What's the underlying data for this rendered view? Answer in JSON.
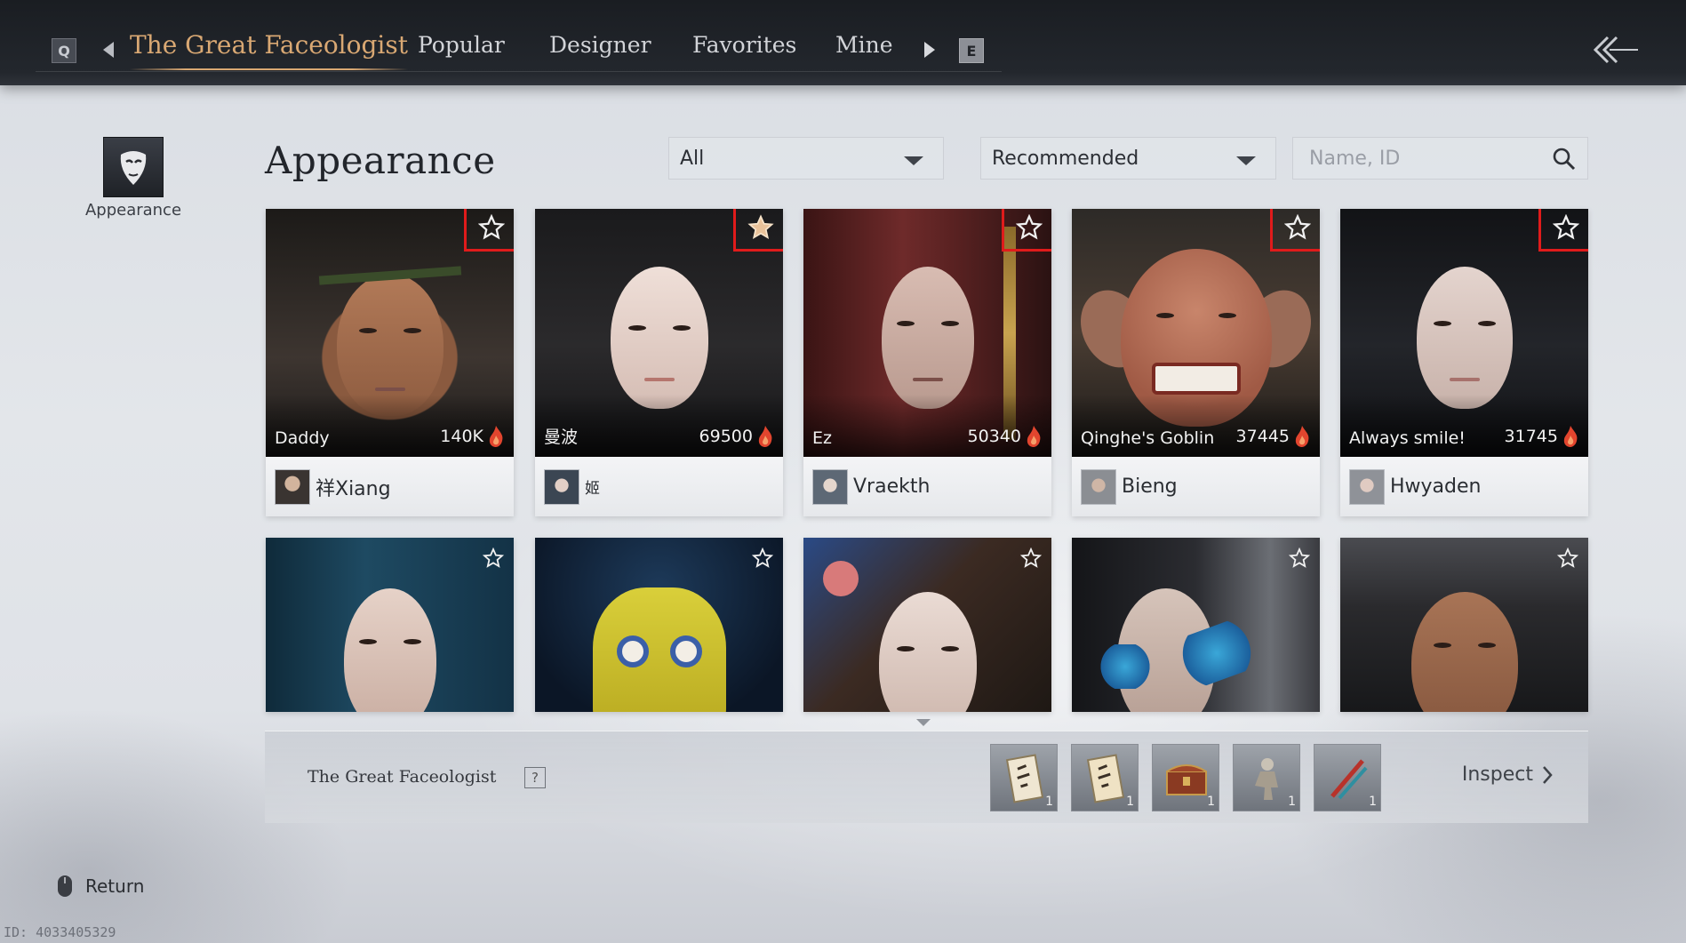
{
  "topbar": {
    "key_left": "Q",
    "key_right": "E",
    "tabs": [
      {
        "label": "The Great Faceologist",
        "active": true
      },
      {
        "label": "Popular",
        "active": false
      },
      {
        "label": "Designer",
        "active": false
      },
      {
        "label": "Favorites",
        "active": false
      },
      {
        "label": "Mine",
        "active": false
      }
    ]
  },
  "sidebar": {
    "items": [
      {
        "label": "Appearance",
        "icon": "mask-icon"
      }
    ]
  },
  "header": {
    "title": "Appearance",
    "filter_category": "All",
    "filter_sort": "Recommended",
    "search_placeholder": "Name, ID"
  },
  "cards": [
    {
      "name": "Daddy",
      "popularity": "140K",
      "creator": "祥Xiang",
      "favorited": false
    },
    {
      "name": "曼波",
      "popularity": "69500",
      "creator": "姬",
      "favorited": true
    },
    {
      "name": "Ez",
      "popularity": "50340",
      "creator": "Vraekth",
      "favorited": false
    },
    {
      "name": "Qinghe's Goblin",
      "popularity": "37445",
      "creator": "Bieng",
      "favorited": false
    },
    {
      "name": "Always smile!",
      "popularity": "31745",
      "creator": "Hwyaden",
      "favorited": false
    },
    {
      "favorited": false
    },
    {
      "favorited": false
    },
    {
      "favorited": false
    },
    {
      "favorited": false
    },
    {
      "favorited": false
    }
  ],
  "bottom_panel": {
    "title": "The Great Faceologist",
    "help": "?",
    "rewards": [
      {
        "icon": "scroll-icon",
        "qty": "1"
      },
      {
        "icon": "scroll-icon",
        "qty": "1"
      },
      {
        "icon": "chest-icon",
        "qty": "1"
      },
      {
        "icon": "figure-icon",
        "qty": "1"
      },
      {
        "icon": "brush-icon",
        "qty": "1"
      }
    ],
    "inspect_label": "Inspect"
  },
  "footer": {
    "return_label": "Return",
    "uid": "ID: 4033405329"
  },
  "colors": {
    "accent": "#d9a873",
    "highlight_box": "#e01b1b",
    "flame": "#e2452e"
  }
}
